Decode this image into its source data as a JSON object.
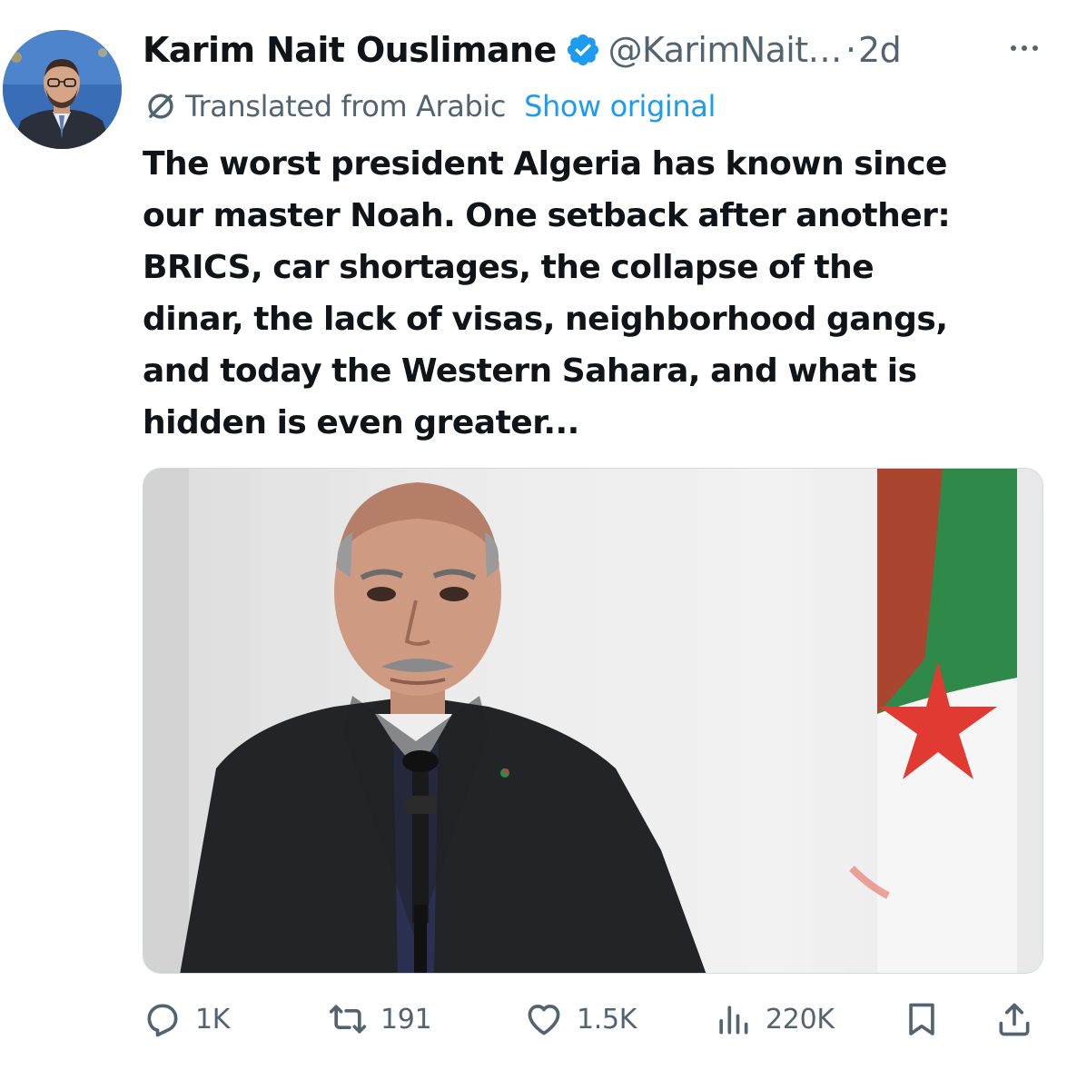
{
  "author": {
    "name": "Karim Nait Ouslimane",
    "handle": "@KarimNait…",
    "separator": "·",
    "time": "2d"
  },
  "translation": {
    "label": "Translated from Arabic",
    "show_original": "Show original"
  },
  "tweet": {
    "text": "The worst president Algeria has known since\nour master Noah. One setback after another:\nBRICS, car shortages, the collapse of the\ndinar, the lack of visas, neighborhood gangs,\nand today the Western Sahara, and what is\nhidden is even greater..."
  },
  "actions": {
    "replies": "1K",
    "reposts": "191",
    "likes": "1.5K",
    "views": "220K"
  },
  "icons": {
    "verified": "verified-badge-icon",
    "more": "more-dots-icon",
    "translate": "translate-icon",
    "reply": "reply-icon",
    "retweet": "retweet-icon",
    "like": "heart-icon",
    "views": "views-chart-icon",
    "bookmark": "bookmark-icon",
    "share": "share-icon"
  },
  "colors": {
    "text": "#0f1419",
    "secondary": "#536471",
    "link": "#1d9bf0",
    "verified": "#1d9bf0"
  }
}
